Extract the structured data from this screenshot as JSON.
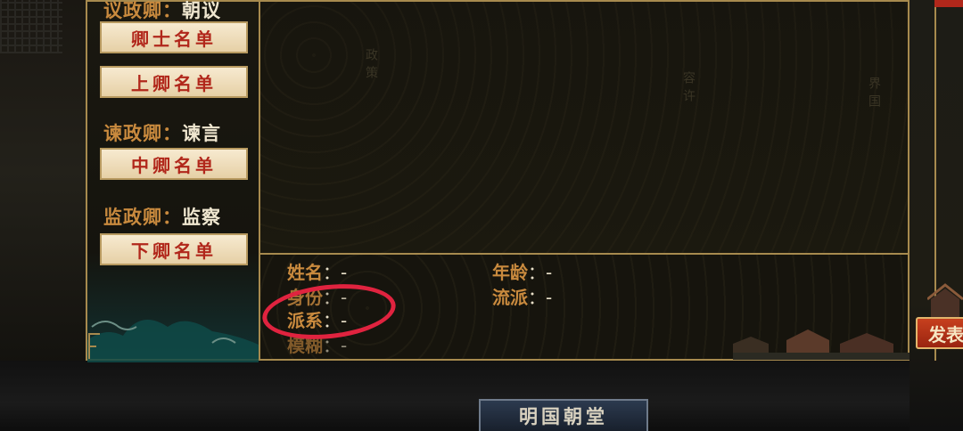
{
  "sidebar": {
    "section1": {
      "title": "议政卿",
      "sep": "：",
      "value": "朝议"
    },
    "btn_qingshi": "卿士名单",
    "btn_shangqing": "上卿名单",
    "section2": {
      "title": "谏政卿",
      "sep": "：",
      "value": "谏言"
    },
    "btn_zhongqing": "中卿名单",
    "section3": {
      "title": "监政卿",
      "sep": "：",
      "value": "监察"
    },
    "btn_xiaqing": "下卿名单"
  },
  "info": {
    "name_label": "姓名",
    "name_value": "：-",
    "age_label": "年龄",
    "age_value": "：-",
    "status_label": "身份",
    "status_value": "：-",
    "school_label": "流派",
    "school_value": "：-",
    "faction_label": "派系",
    "faction_value": "：-",
    "mood_label": "模糊",
    "mood_value": "：-"
  },
  "faint_cols": [
    "政策",
    "容许",
    "界国"
  ],
  "action_button": "发表",
  "bottom_tab": "明国朝堂",
  "colors": {
    "accent": "#c98a3e",
    "button_text": "#b1271b",
    "annotation": "#e0233f"
  }
}
